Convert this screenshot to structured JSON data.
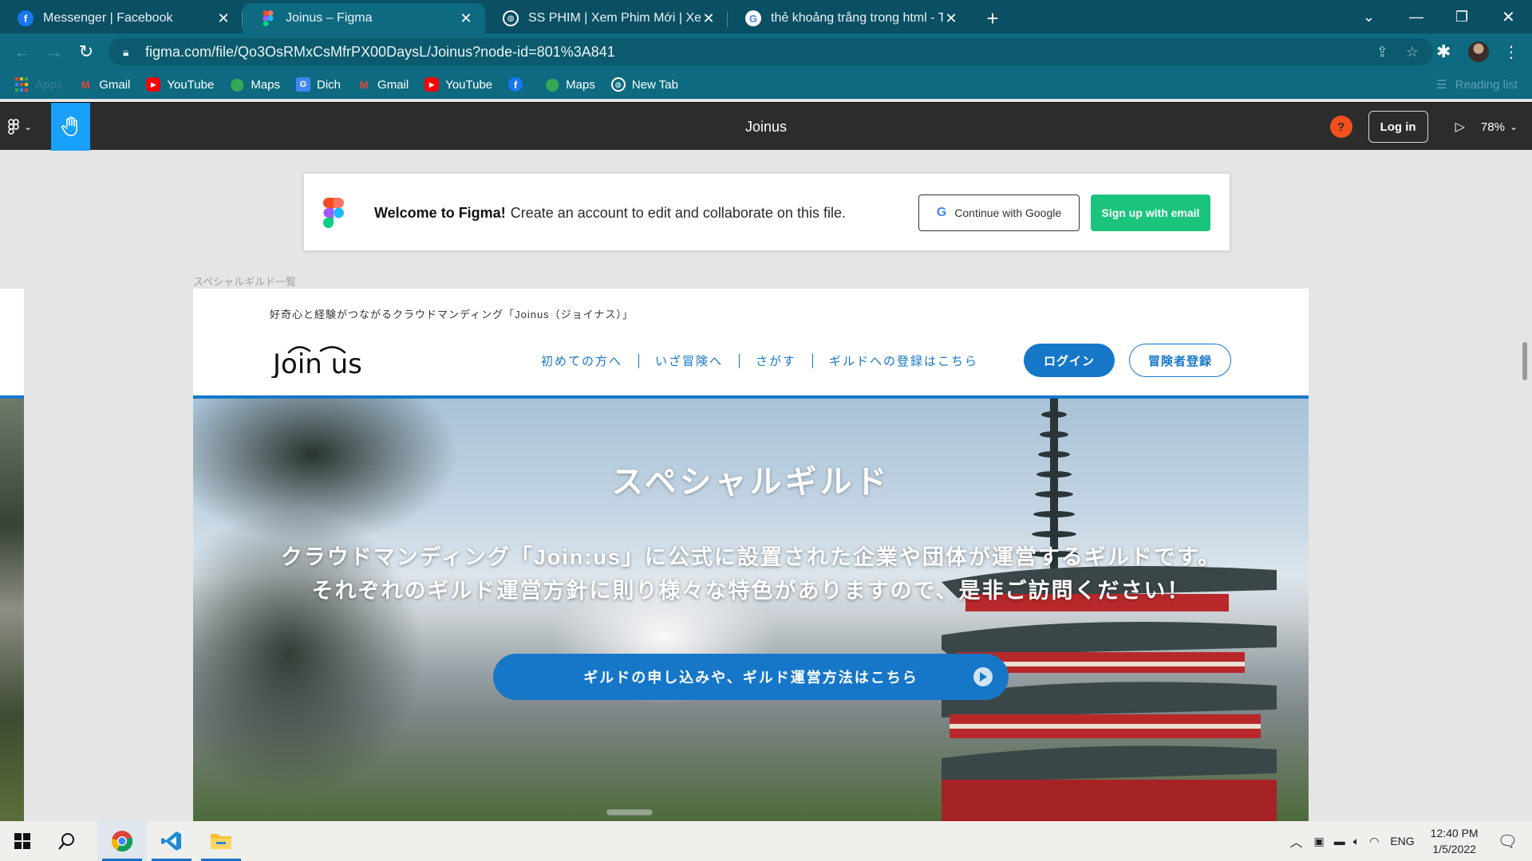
{
  "browser": {
    "tabs": [
      {
        "title": "Messenger | Facebook",
        "icon": "facebook-icon",
        "active": false
      },
      {
        "title": "Joinus – Figma",
        "icon": "figma-icon",
        "active": true
      },
      {
        "title": "SS PHIM | Xem Phim Mới | Xem P",
        "icon": "globe-icon",
        "active": false
      },
      {
        "title": "thẻ khoảng trắng trong html - Tì",
        "icon": "google-icon",
        "active": false
      }
    ],
    "url": "figma.com/file/Qo3OsRMxCsMfrPX00DaysL/Joinus?node-id=801%3A841",
    "bookmarks": [
      "Apps",
      "Gmail",
      "YouTube",
      "Maps",
      "Dich",
      "Gmail",
      "YouTube",
      "",
      "Maps",
      "New Tab"
    ],
    "reading_list": "Reading list"
  },
  "figma": {
    "file_title": "Joinus",
    "help": "?",
    "login": "Log in",
    "zoom": "78%",
    "welcome_bold": "Welcome to Figma!",
    "welcome_text": "Create an account to edit and collaborate on this file.",
    "google_button": "Continue with Google",
    "email_button": "Sign up with email",
    "frame_label": "スペシャルギルド一覧"
  },
  "site": {
    "tagline": "好奇心と経験がつながるクラウドマンディング「Joinus（ジョイナス）」",
    "logo": "Join us",
    "nav": [
      "初めての方へ",
      "いざ冒険へ",
      "さがす",
      "ギルドへの登録はこちら"
    ],
    "login": "ログイン",
    "register": "冒険者登録",
    "hero_title": "スペシャルギルド",
    "hero_line1": "クラウドマンディング「Join:us」に公式に設置された企業や団体が運営するギルドです。",
    "hero_line2": "それぞれのギルド運営方針に則り様々な特色がありますので、是非ご訪問ください！",
    "hero_button": "ギルドの申し込みや、ギルド運営方法はこちら"
  },
  "taskbar": {
    "lang": "ENG",
    "time": "12:40 PM",
    "date": "1/5/2022"
  },
  "colors": {
    "chrome": "#0d6a80",
    "figma_blue": "#18a0fb",
    "site_blue": "#1677c8",
    "signup_green": "#1bc47d"
  }
}
